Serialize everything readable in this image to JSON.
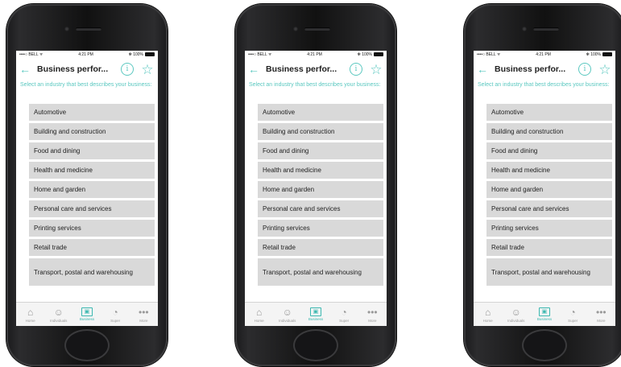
{
  "status": {
    "carrier": "••••○ BELL ᯤ",
    "time": "4:21 PM",
    "battery": "✻ 100%"
  },
  "nav": {
    "title": "Business perfor...",
    "info_symbol": "i",
    "star_symbol": "☆",
    "back_symbol": "←"
  },
  "prompt": "Select an industry that best describes your business:",
  "industries": [
    "Automotive",
    "Building and construction",
    "Food and dining",
    "Health and medicine",
    "Home and garden",
    "Personal care and services",
    "Printing services",
    "Retail trade",
    "Transport, postal and warehousing"
  ],
  "tabs": [
    {
      "label": "Home",
      "icon": "home-icon",
      "glyph": "⌂"
    },
    {
      "label": "Individuals",
      "icon": "people-icon",
      "glyph": "☺"
    },
    {
      "label": "Business",
      "icon": "briefcase-icon",
      "glyph": "▣"
    },
    {
      "label": "Super",
      "icon": "piggy-bank-icon",
      "glyph": "◔"
    },
    {
      "label": "More",
      "icon": "more-icon",
      "glyph": "•••"
    }
  ],
  "active_tab": "Business",
  "colors": {
    "accent": "#5bc8c0",
    "item_bg": "#d9d9d9"
  }
}
